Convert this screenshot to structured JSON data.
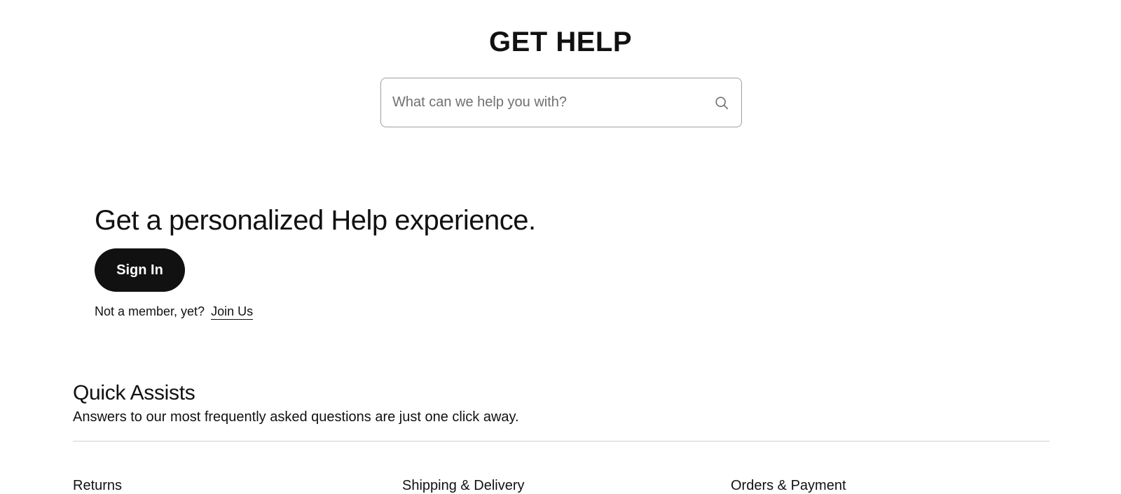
{
  "header": {
    "title": "GET HELP"
  },
  "search": {
    "placeholder": "What can we help you with?",
    "value": "",
    "icon": "search-icon"
  },
  "promo": {
    "heading": "Get a personalized Help experience.",
    "signin_label": "Sign In",
    "member_text": "Not a member, yet?",
    "join_label": "Join Us"
  },
  "quick_assists": {
    "heading": "Quick Assists",
    "subtitle": "Answers to our most frequently asked questions are just one click away.",
    "categories": [
      {
        "label": "Returns"
      },
      {
        "label": "Shipping & Delivery"
      },
      {
        "label": "Orders & Payment"
      }
    ]
  },
  "colors": {
    "text": "#111111",
    "button_bg": "#111111",
    "button_text": "#ffffff",
    "border": "#9e9e9e",
    "divider": "#cfcfcf",
    "placeholder": "#707070"
  }
}
